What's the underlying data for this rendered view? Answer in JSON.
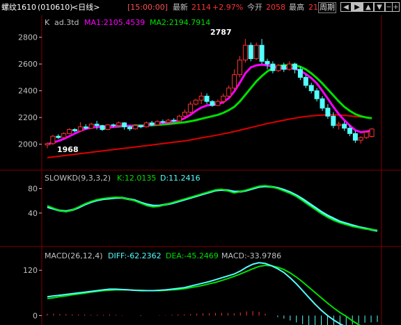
{
  "header": {
    "symbol_name": "螺纹1610",
    "symbol_code": "(010610)",
    "period": "<日线>",
    "time": "[15:00:00]",
    "last_label": "最新",
    "last_value": "2114",
    "change_pct": "+2.97%",
    "open_label": "今开",
    "open_value": "2058",
    "high_label": "最高",
    "high_value": "21",
    "zhou_label": "周期",
    "buttons": [
      "left-arrow-icon",
      "right-arrow-icon",
      "up-arrow-icon",
      "down-arrow-icon",
      "zoom-out-icon",
      "zoom-in-icon"
    ]
  },
  "colors": {
    "up": "#ff3232",
    "down": "#54ffff",
    "ma1": "#ff00ff",
    "ma2": "#00e000",
    "ma_long": "#e00000",
    "grid": "#800000",
    "axis_text": "#c0c0c0"
  },
  "chart_data": [
    {
      "type": "candlestick",
      "legend": {
        "k": "K",
        "name": "ad.3td",
        "ma1_label": "MA1:2105.4539",
        "ma2_label": "MA2:2194.7914"
      },
      "ylim": [
        1900,
        2850
      ],
      "yticks": [
        2000,
        2200,
        2400,
        2600,
        2800
      ],
      "annotations": {
        "high": "2787",
        "low": "1968"
      },
      "candles": [
        [
          1995,
          2005,
          1970,
          2015
        ],
        [
          2005,
          2060,
          1995,
          2070
        ],
        [
          2060,
          2050,
          2040,
          2075
        ],
        [
          2050,
          2080,
          2045,
          2090
        ],
        [
          2080,
          2110,
          2075,
          2120
        ],
        [
          2110,
          2100,
          2090,
          2120
        ],
        [
          2100,
          2130,
          2095,
          2165
        ],
        [
          2130,
          2120,
          2110,
          2150
        ],
        [
          2120,
          2150,
          2115,
          2160
        ],
        [
          2150,
          2140,
          2110,
          2175
        ],
        [
          2140,
          2110,
          2100,
          2145
        ],
        [
          2110,
          2145,
          2105,
          2150
        ],
        [
          2145,
          2140,
          2125,
          2155
        ],
        [
          2140,
          2160,
          2135,
          2170
        ],
        [
          2160,
          2130,
          2110,
          2165
        ],
        [
          2130,
          2115,
          2100,
          2140
        ],
        [
          2115,
          2140,
          2110,
          2150
        ],
        [
          2140,
          2130,
          2120,
          2145
        ],
        [
          2130,
          2160,
          2125,
          2170
        ],
        [
          2160,
          2145,
          2135,
          2175
        ],
        [
          2145,
          2170,
          2140,
          2180
        ],
        [
          2170,
          2165,
          2155,
          2185
        ],
        [
          2165,
          2180,
          2160,
          2190
        ],
        [
          2180,
          2175,
          2165,
          2195
        ],
        [
          2175,
          2210,
          2170,
          2220
        ],
        [
          2210,
          2240,
          2200,
          2260
        ],
        [
          2240,
          2300,
          2230,
          2320
        ],
        [
          2300,
          2330,
          2290,
          2340
        ],
        [
          2330,
          2360,
          2300,
          2390
        ],
        [
          2360,
          2320,
          2300,
          2380
        ],
        [
          2320,
          2290,
          2280,
          2330
        ],
        [
          2290,
          2320,
          2285,
          2335
        ],
        [
          2320,
          2360,
          2300,
          2380
        ],
        [
          2360,
          2420,
          2350,
          2440
        ],
        [
          2420,
          2520,
          2410,
          2560
        ],
        [
          2520,
          2630,
          2500,
          2660
        ],
        [
          2630,
          2740,
          2610,
          2787
        ],
        [
          2740,
          2640,
          2620,
          2760
        ],
        [
          2640,
          2740,
          2630,
          2760
        ],
        [
          2740,
          2620,
          2600,
          2787
        ],
        [
          2620,
          2600,
          2560,
          2640
        ],
        [
          2600,
          2550,
          2530,
          2620
        ],
        [
          2550,
          2590,
          2540,
          2600
        ],
        [
          2590,
          2560,
          2540,
          2610
        ],
        [
          2560,
          2600,
          2550,
          2620
        ],
        [
          2600,
          2560,
          2530,
          2610
        ],
        [
          2560,
          2500,
          2480,
          2580
        ],
        [
          2500,
          2440,
          2420,
          2520
        ],
        [
          2440,
          2400,
          2380,
          2460
        ],
        [
          2400,
          2340,
          2320,
          2420
        ],
        [
          2340,
          2270,
          2250,
          2360
        ],
        [
          2270,
          2210,
          2190,
          2300
        ],
        [
          2210,
          2140,
          2120,
          2240
        ],
        [
          2140,
          2150,
          2110,
          2170
        ],
        [
          2150,
          2120,
          2100,
          2170
        ],
        [
          2120,
          2080,
          2060,
          2140
        ],
        [
          2080,
          2030,
          2010,
          2100
        ],
        [
          2030,
          2050,
          2005,
          2060
        ],
        [
          2050,
          2090,
          2040,
          2100
        ],
        [
          2058,
          2114,
          2050,
          2120
        ]
      ],
      "ma1": [
        2000,
        2012,
        2025,
        2040,
        2060,
        2080,
        2100,
        2115,
        2125,
        2130,
        2130,
        2128,
        2130,
        2138,
        2140,
        2138,
        2135,
        2135,
        2140,
        2148,
        2152,
        2160,
        2165,
        2170,
        2178,
        2195,
        2220,
        2250,
        2275,
        2290,
        2295,
        2300,
        2315,
        2345,
        2395,
        2460,
        2530,
        2575,
        2590,
        2595,
        2590,
        2580,
        2570,
        2565,
        2568,
        2565,
        2550,
        2525,
        2495,
        2455,
        2400,
        2340,
        2280,
        2225,
        2180,
        2140,
        2105,
        2090,
        2095,
        2105
      ],
      "ma2": [
        null,
        null,
        null,
        null,
        null,
        null,
        null,
        null,
        null,
        null,
        2120,
        2125,
        2130,
        2133,
        2136,
        2138,
        2140,
        2140,
        2140,
        2142,
        2145,
        2148,
        2152,
        2156,
        2160,
        2165,
        2172,
        2180,
        2190,
        2200,
        2210,
        2220,
        2235,
        2255,
        2280,
        2320,
        2370,
        2420,
        2470,
        2510,
        2545,
        2570,
        2585,
        2590,
        2592,
        2590,
        2580,
        2560,
        2530,
        2495,
        2455,
        2410,
        2365,
        2320,
        2280,
        2250,
        2225,
        2210,
        2200,
        2195
      ],
      "ma3": [
        1900,
        1905,
        1910,
        1915,
        1920,
        1925,
        1930,
        1935,
        1940,
        1945,
        1950,
        1955,
        1960,
        1965,
        1970,
        1975,
        1980,
        1985,
        1990,
        1995,
        2000,
        2005,
        2010,
        2015,
        2020,
        2025,
        2032,
        2040,
        2048,
        2055,
        2062,
        2070,
        2078,
        2086,
        2095,
        2105,
        2115,
        2125,
        2135,
        2145,
        2155,
        2163,
        2172,
        2180,
        2188,
        2195,
        2202,
        2208,
        2212,
        2215,
        2218,
        2220,
        2220,
        2219,
        2216,
        2212,
        2208,
        2204,
        2200,
        2196
      ]
    },
    {
      "type": "line",
      "legend": {
        "name": "SLOWKD(9,3,3,2)",
        "k_label": "K:12.0135",
        "d_label": "D:11.2416"
      },
      "ylim": [
        0,
        100
      ],
      "yticks": [
        40,
        80
      ],
      "series": [
        {
          "name": "K",
          "values": [
            52,
            48,
            44,
            42,
            45,
            50,
            55,
            59,
            62,
            64,
            65,
            66,
            65,
            63,
            60,
            56,
            52,
            50,
            51,
            54,
            57,
            60,
            63,
            66,
            69,
            72,
            75,
            78,
            79,
            76,
            73,
            75,
            78,
            81,
            84,
            85,
            83,
            80,
            76,
            72,
            67,
            60,
            53,
            46,
            39,
            33,
            28,
            24,
            21,
            18,
            16,
            14,
            13,
            12
          ]
        },
        {
          "name": "D",
          "values": [
            50,
            47,
            44,
            43,
            45,
            49,
            54,
            58,
            61,
            63,
            64,
            65,
            65,
            63,
            61,
            57,
            54,
            52,
            52,
            54,
            56,
            59,
            62,
            65,
            68,
            71,
            74,
            77,
            78,
            77,
            75,
            75,
            77,
            80,
            83,
            84,
            83,
            81,
            78,
            74,
            69,
            63,
            56,
            49,
            42,
            36,
            31,
            26,
            23,
            20,
            17,
            15,
            13,
            11
          ]
        }
      ]
    },
    {
      "type": "line",
      "legend": {
        "name": "MACD(26,12,4)",
        "diff_label": "DIFF:-62.2362",
        "dea_label": "DEA:-45.2469",
        "macd_label": "MACD:-33.9786"
      },
      "ylim": [
        -25,
        170
      ],
      "yticks": [
        0,
        120
      ],
      "series": [
        {
          "name": "DIFF",
          "values": [
            50,
            52,
            54,
            56,
            58,
            60,
            62,
            64,
            66,
            68,
            70,
            70,
            69,
            68,
            67,
            66,
            66,
            66,
            67,
            68,
            70,
            72,
            74,
            78,
            82,
            86,
            90,
            95,
            100,
            105,
            110,
            118,
            128,
            136,
            140,
            138,
            132,
            124,
            114,
            100,
            84,
            66,
            48,
            30,
            14,
            0,
            -12,
            -22,
            -30,
            -38,
            -45,
            -52,
            -58,
            -62
          ]
        },
        {
          "name": "DEA",
          "values": [
            45,
            47,
            50,
            52,
            55,
            57,
            59,
            62,
            64,
            66,
            67,
            68,
            68,
            68,
            67,
            67,
            66,
            66,
            66,
            67,
            68,
            69,
            71,
            74,
            77,
            80,
            84,
            88,
            93,
            98,
            104,
            110,
            117,
            124,
            130,
            133,
            132,
            128,
            122,
            113,
            102,
            89,
            75,
            61,
            47,
            33,
            20,
            8,
            -2,
            -14,
            -24,
            -33,
            -40,
            -45
          ]
        }
      ],
      "bars": [
        5,
        5,
        4,
        4,
        3,
        3,
        3,
        2,
        2,
        2,
        3,
        2,
        1,
        0,
        0,
        -1,
        0,
        0,
        1,
        1,
        2,
        3,
        3,
        4,
        5,
        6,
        6,
        7,
        7,
        7,
        6,
        8,
        11,
        12,
        10,
        5,
        0,
        -4,
        -8,
        -13,
        -18,
        -23,
        -27,
        -31,
        -33,
        -33,
        -32,
        -30,
        -28,
        -24,
        -21,
        -19,
        -18,
        -17
      ]
    }
  ]
}
